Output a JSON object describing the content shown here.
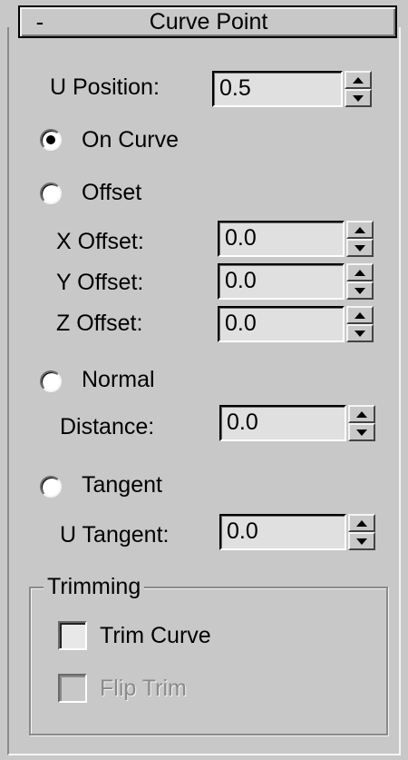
{
  "rollout": {
    "collapse_sign": "-",
    "title": "Curve Point"
  },
  "u_position": {
    "label": "U Position:",
    "value": "0.5"
  },
  "modes": {
    "on_curve": {
      "label": "On Curve",
      "selected": true
    },
    "offset": {
      "label": "Offset",
      "selected": false
    },
    "normal": {
      "label": "Normal",
      "selected": false
    },
    "tangent": {
      "label": "Tangent",
      "selected": false
    }
  },
  "offset_fields": {
    "x": {
      "label": "X Offset:",
      "value": "0.0"
    },
    "y": {
      "label": "Y Offset:",
      "value": "0.0"
    },
    "z": {
      "label": "Z Offset:",
      "value": "0.0"
    }
  },
  "distance": {
    "label": "Distance:",
    "value": "0.0"
  },
  "u_tangent": {
    "label": "U Tangent:",
    "value": "0.0"
  },
  "trimming": {
    "title": "Trimming",
    "trim_curve": {
      "label": "Trim Curve",
      "checked": false
    },
    "flip_trim": {
      "label": "Flip Trim",
      "checked": false,
      "enabled": false
    }
  },
  "icons": {
    "spinner_up": "triangle-up-icon",
    "spinner_down": "triangle-down-icon"
  },
  "colors": {
    "panel_bg": "#c8c8c8",
    "field_bg": "#e0e0e0",
    "disabled_text": "#8a8a8a"
  }
}
